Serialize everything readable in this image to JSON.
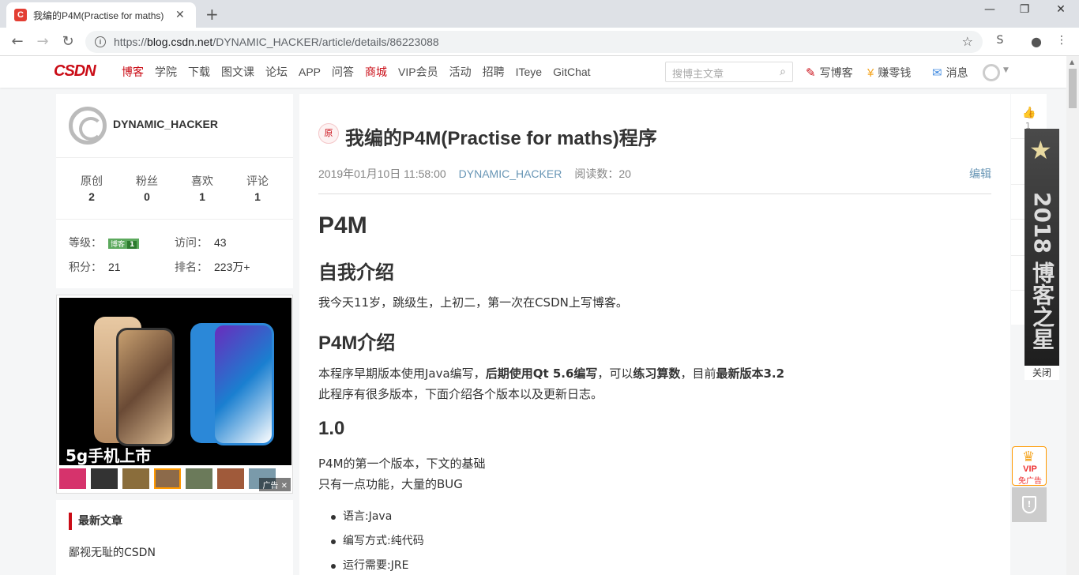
{
  "browser": {
    "tab_title": "我编的P4M(Practise for maths)",
    "tab_close": "✕",
    "new_tab": "+",
    "url_prefix": "https://",
    "url_host": "blog.csdn.net",
    "url_path": "/DYNAMIC_HACKER/article/details/86223088",
    "win_min": "—",
    "win_max": "❐",
    "win_close": "✕"
  },
  "header": {
    "logo": "CSDN",
    "nav": [
      "博客",
      "学院",
      "下载",
      "图文课",
      "论坛",
      "APP",
      "问答",
      "商城",
      "VIP会员",
      "活动",
      "招聘",
      "ITeye",
      "GitChat"
    ],
    "search_placeholder": "搜博主文章",
    "write_blog": "写博客",
    "earn": "赚零钱",
    "messages": "消息"
  },
  "profile": {
    "username": "DYNAMIC_HACKER",
    "stats": [
      {
        "label": "原创",
        "value": "2"
      },
      {
        "label": "粉丝",
        "value": "0"
      },
      {
        "label": "喜欢",
        "value": "1"
      },
      {
        "label": "评论",
        "value": "1"
      }
    ],
    "level_label": "等级：",
    "level_badge": "博客",
    "level_num": "1",
    "visits_label": "访问：",
    "visits": "43",
    "points_label": "积分：",
    "points": "21",
    "rank_label": "排名：",
    "rank": "223万+"
  },
  "ad": {
    "text": "5g手机上市",
    "tag": "广告"
  },
  "recent": {
    "title": "最新文章",
    "items": [
      "鄙视无耻的CSDN"
    ]
  },
  "article": {
    "orig_tag": "原",
    "title": "我编的P4M(Practise for maths)程序",
    "date": "2019年01月10日 11:58:00",
    "author": "DYNAMIC_HACKER",
    "reads_label": "阅读数：",
    "reads": "20",
    "edit": "编辑",
    "h1": "P4M",
    "h2_intro": "自我介绍",
    "p_intro": "我今天11岁，跳级生，上初二，第一次在CSDN上写博客。",
    "h2_p4m": "P4M介绍",
    "p_p4m_a": "本程序早期版本使用Java编写，",
    "p_p4m_b": "后期使用Qt 5.6编写",
    "p_p4m_c": "，可以",
    "p_p4m_d": "练习算数",
    "p_p4m_e": "，目前",
    "p_p4m_f": "最新版本3.2",
    "p_p4m_2": "此程序有很多版本，下面介绍各个版本以及更新日志。",
    "h2_v10": "1.0",
    "p_v10_1": "P4M的第一个版本，下文的基础",
    "p_v10_2": "只有一点功能，大量的BUG",
    "list": [
      "语言:Java",
      "编写方式:纯代码",
      "运行需要:JRE"
    ]
  },
  "right": {
    "like_count": "1",
    "star_text": "2018 博客之星",
    "close": "关闭",
    "vip": "VIP",
    "vip_ad": "免广告"
  }
}
